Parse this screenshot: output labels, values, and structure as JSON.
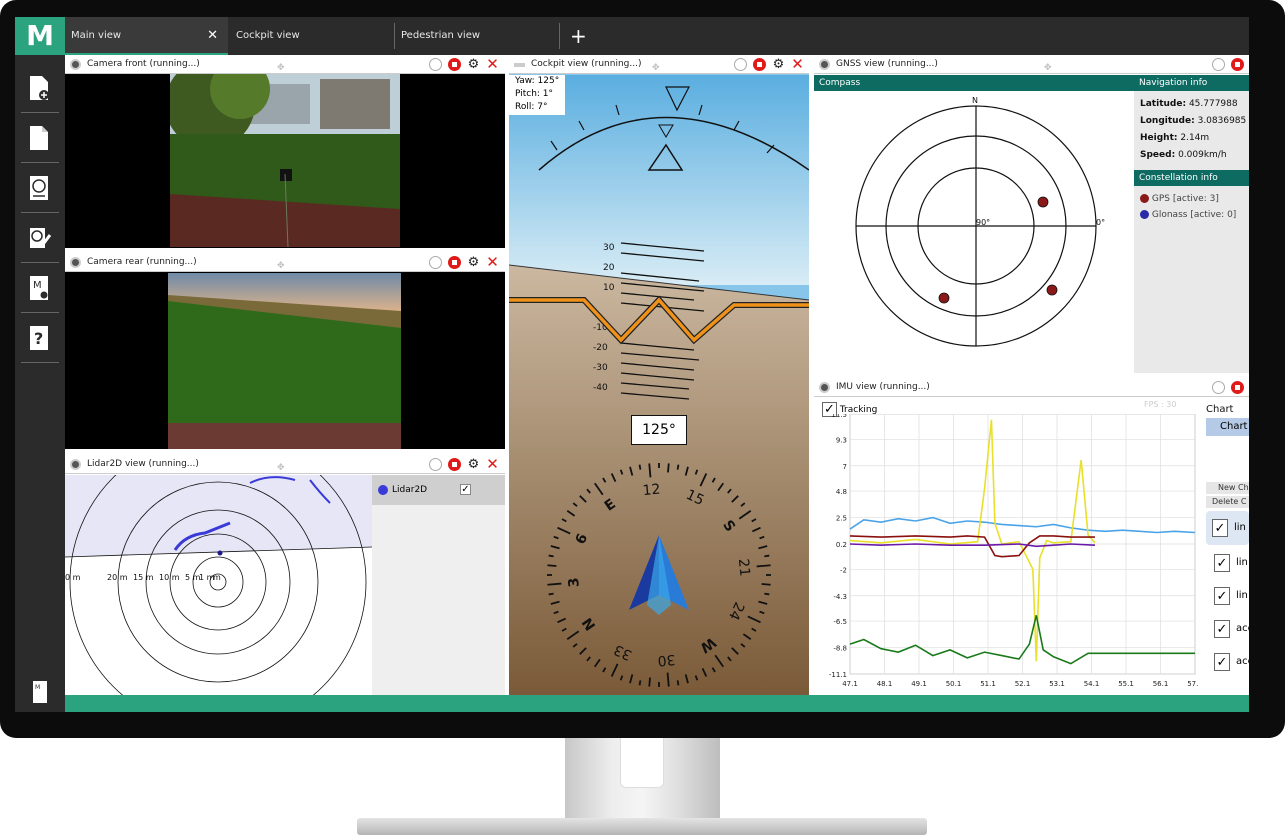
{
  "app": {
    "logo": "M",
    "accent": "#2aa37e"
  },
  "tabs": [
    {
      "label": "Main view",
      "close": "✕"
    },
    {
      "label": "Cockpit view"
    },
    {
      "label": "Pedestrian view"
    }
  ],
  "tab_add": "+",
  "sidebar": {
    "items": [
      "new-file-icon",
      "document-icon",
      "sensor-recorder-icon",
      "edit-sensor-icon",
      "map-settings-icon",
      "help-icon",
      "manual-icon"
    ]
  },
  "panels": {
    "camera_front": {
      "title": "Camera front (running...)"
    },
    "camera_rear": {
      "title": "Camera rear (running...)"
    },
    "lidar": {
      "title": "Lidar2D view (running...)",
      "legend": "Lidar2D",
      "ranges": [
        "0 m",
        "20 m",
        "15 m",
        "10 m",
        "5 m",
        "1 m",
        "m"
      ]
    },
    "cockpit": {
      "title": "Cockpit view (running...)",
      "yaw": "Yaw: 125°",
      "pitch": "Pitch: 1°",
      "roll": "Roll: 7°",
      "pitch_up": [
        "30",
        "20",
        "10"
      ],
      "pitch_down": [
        "-10",
        "-20",
        "-30",
        "-40"
      ],
      "heading": "125°",
      "compass": [
        "12",
        "15",
        "S",
        "21",
        "24",
        "W",
        "30",
        "33",
        "N",
        "3",
        "6",
        "E"
      ]
    },
    "gnss": {
      "title": "GNSS view (running...)",
      "compass_label": "Compass",
      "nav_header": "Navigation info",
      "latitude_label": "Latitude:",
      "latitude": "45.777988",
      "longitude_label": "Longitude:",
      "longitude": "3.0836985",
      "height_label": "Height:",
      "height": "2.14m",
      "speed_label": "Speed:",
      "speed": "0.009km/h",
      "const_header": "Constellation info",
      "gps": "GPS [active: 3]",
      "glonass": "Glonass [active: 0]",
      "north": "N",
      "deg90": "90°",
      "deg0": "0°"
    },
    "imu": {
      "title": "IMU view (running...)",
      "tracking": "Tracking",
      "fps": "FPS : 30",
      "chart_label": "Chart",
      "chart_btn": "Chart",
      "new_btn": "New Ch",
      "delete_btn": "Delete C",
      "series_labels": [
        "lin",
        "lin",
        "lin",
        "acc",
        "acc"
      ]
    }
  },
  "chart_data": {
    "type": "line",
    "title": "",
    "xlabel": "",
    "ylabel": "",
    "y_ticks": [
      "11.5",
      "9.3",
      "7",
      "4.8",
      "2.5",
      "0.2",
      "-2",
      "-4.3",
      "-6.5",
      "-8.8",
      "-11.1"
    ],
    "x_ticks": [
      "47.1",
      "48.1",
      "49.1",
      "50.1",
      "51.1",
      "52.1",
      "53.1",
      "54.1",
      "55.1",
      "56.1",
      "57.1"
    ],
    "xlim": [
      47.1,
      57.1
    ],
    "ylim": [
      -11.1,
      11.5
    ],
    "series": [
      {
        "color": "#4aa3e8",
        "x": [
          47.1,
          47.5,
          48,
          48.5,
          49,
          49.5,
          50,
          50.5,
          51,
          51.5,
          52,
          52.5,
          53,
          53.5,
          54,
          54.5,
          55,
          55.5,
          56,
          56.5,
          57.1
        ],
        "values": [
          1.5,
          2.3,
          2.1,
          2.4,
          2.2,
          2.5,
          2.0,
          2.2,
          2.1,
          1.9,
          1.8,
          1.7,
          1.9,
          1.6,
          1.4,
          1.3,
          1.4,
          1.3,
          1.2,
          1.3,
          1.2
        ]
      },
      {
        "color": "#e8e02a",
        "x": [
          47.1,
          48,
          49,
          50,
          50.8,
          51,
          51.2,
          51.3,
          51.5,
          52,
          52.4,
          52.5,
          52.6,
          52.8,
          53,
          53.5,
          53.8,
          54,
          54.2
        ],
        "values": [
          0.5,
          0.3,
          0.6,
          0.2,
          0.4,
          5.0,
          11.0,
          2.0,
          0.2,
          0.4,
          -2.0,
          -10.0,
          -1.0,
          0.5,
          0.3,
          0.4,
          7.5,
          1.0,
          0.3
        ]
      },
      {
        "color": "#8a1010",
        "x": [
          47.1,
          48,
          49,
          50,
          50.5,
          51,
          51.3,
          51.5,
          52,
          52.3,
          52.6,
          53,
          53.5,
          54.2
        ],
        "values": [
          0.9,
          0.8,
          0.9,
          0.8,
          0.9,
          0.8,
          -0.8,
          -0.9,
          -0.8,
          0.3,
          0.9,
          0.9,
          0.8,
          0.8
        ]
      },
      {
        "color": "#6a1aa8",
        "x": [
          47.1,
          48,
          49,
          50,
          51,
          52,
          52.5,
          53,
          53.5,
          54.2
        ],
        "values": [
          0.2,
          0.1,
          0.2,
          0.1,
          0.1,
          0.2,
          0.0,
          0.1,
          0.2,
          0.1
        ]
      },
      {
        "color": "#1a7a1a",
        "x": [
          47.1,
          47.5,
          48,
          48.5,
          49,
          49.5,
          50,
          50.5,
          51,
          51.5,
          52,
          52.3,
          52.5,
          52.7,
          53,
          53.5,
          54,
          55,
          56,
          57.1
        ],
        "values": [
          -8.5,
          -8.1,
          -8.9,
          -9.2,
          -8.6,
          -9.5,
          -9.0,
          -9.7,
          -9.2,
          -9.5,
          -9.8,
          -8.5,
          -6.0,
          -9.0,
          -9.6,
          -10.2,
          -9.3,
          -9.3,
          -9.3,
          -9.3
        ]
      }
    ]
  }
}
